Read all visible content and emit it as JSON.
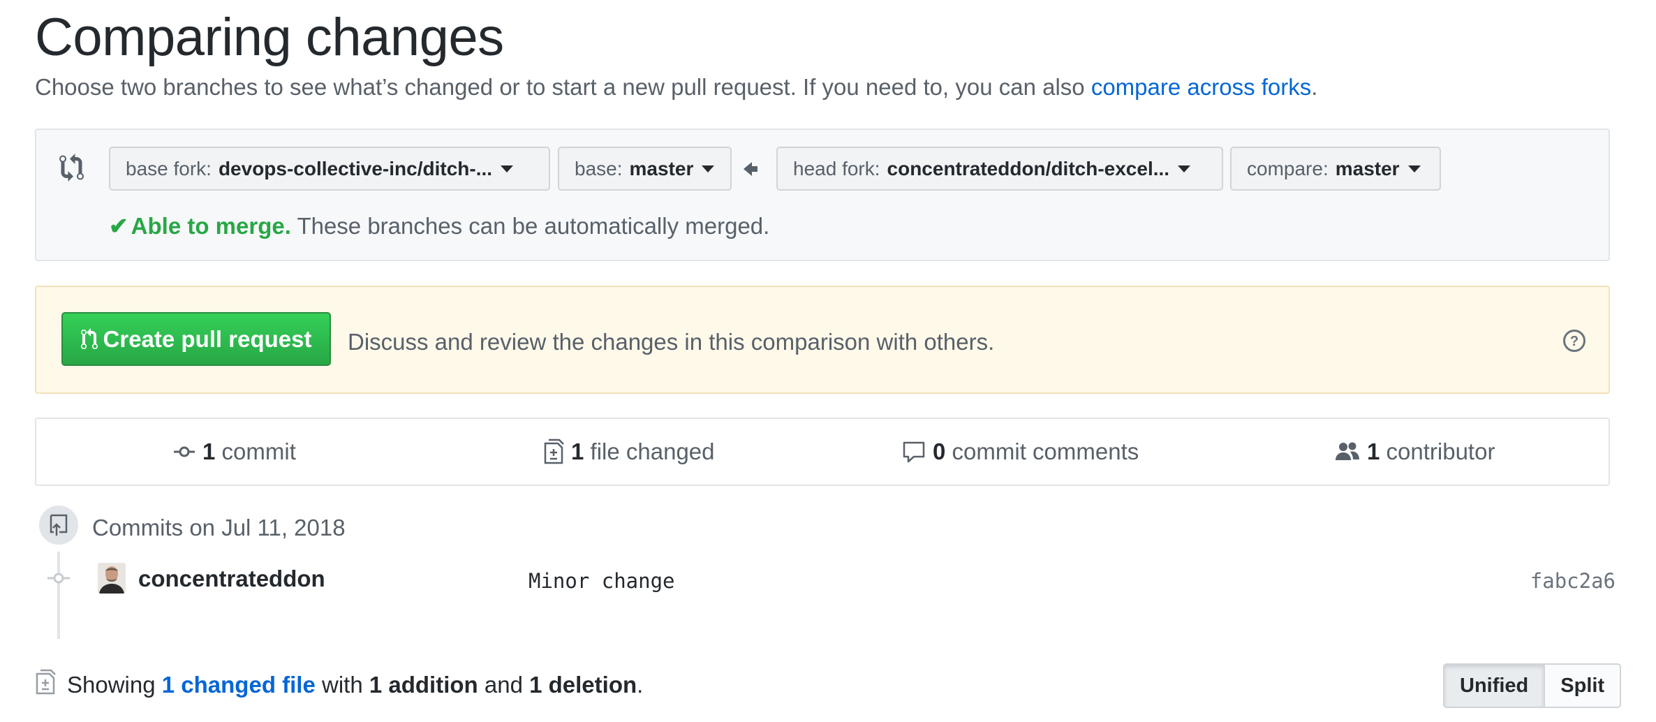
{
  "header": {
    "title": "Comparing changes",
    "subtitle_prefix": "Choose two branches to see what’s changed or to start a new pull request. If you need to, you can also ",
    "subtitle_link": "compare across forks",
    "subtitle_suffix": "."
  },
  "range": {
    "base_fork": {
      "label": "base fork:",
      "value": "devops-collective-inc/ditch-..."
    },
    "base": {
      "label": "base:",
      "value": "master"
    },
    "head_fork": {
      "label": "head fork:",
      "value": "concentrateddon/ditch-excel..."
    },
    "compare": {
      "label": "compare:",
      "value": "master"
    },
    "merge_status_strong": "Able to merge.",
    "merge_status_text": " These branches can be automatically merged."
  },
  "pull_request": {
    "button_label": "Create pull request",
    "description": "Discuss and review the changes in this comparison with others."
  },
  "stats": {
    "commits": {
      "count": "1",
      "label": " commit"
    },
    "files": {
      "count": "1",
      "label": " file changed"
    },
    "comments": {
      "count": "0",
      "label": " commit comments"
    },
    "contributors": {
      "count": "1",
      "label": " contributor"
    }
  },
  "commits": {
    "date_heading": "Commits on Jul 11, 2018",
    "items": [
      {
        "author": "concentrateddon",
        "message": "Minor change",
        "sha": "fabc2a6"
      }
    ]
  },
  "summary": {
    "prefix": "Showing ",
    "files_link": "1 changed file",
    "middle1": " with ",
    "additions": "1 addition",
    "middle2": " and ",
    "deletions": "1 deletion",
    "suffix": "."
  },
  "view_toggle": {
    "unified": "Unified",
    "split": "Split"
  },
  "colors": {
    "accent": "#0366d6",
    "success": "#28a745",
    "warning_bg": "#fff9ea"
  }
}
